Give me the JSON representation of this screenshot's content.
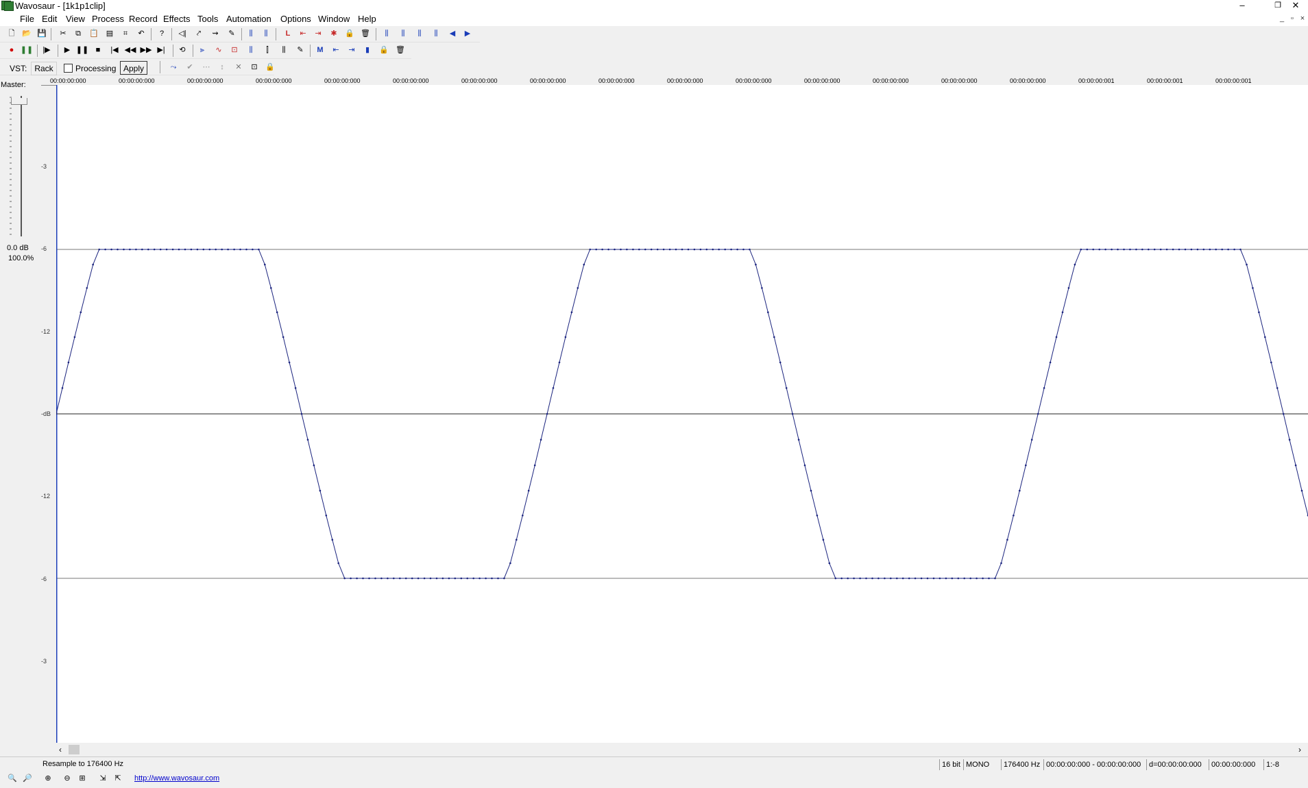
{
  "window": {
    "title": "Wavosaur - [1k1p1clip]",
    "controls": [
      "–",
      "❐",
      "✕"
    ],
    "mdi_controls": [
      "_",
      "▫",
      "×"
    ]
  },
  "menu": [
    "File",
    "Edit",
    "View",
    "Process",
    "Record",
    "Effects",
    "Tools",
    "Automation",
    "Options",
    "Window",
    "Help"
  ],
  "toolbar1": [
    "🗋",
    "📂",
    "💾",
    "✂",
    "⧉",
    "📋",
    "▤",
    "⌗",
    "↶",
    "?",
    "◁|",
    "⤤",
    "⇝",
    "✎",
    "⫼",
    "⫼",
    "L",
    "⇤",
    "⇥",
    "✱",
    "🔒",
    "🗑",
    "⫼",
    "⫼",
    "⫼",
    "⫼",
    "◀",
    "▶"
  ],
  "toolbar2": [
    "●",
    "❚❚",
    "|▶",
    "▶",
    "❚❚",
    "■",
    "|◀",
    "◀◀",
    "▶▶",
    "▶|",
    "⟲",
    "⫸",
    "∿",
    "⊡",
    "⫼",
    "⫿",
    "⫼",
    "✎",
    "M",
    "⇤",
    "⇥",
    "▮",
    "🔒",
    "🗑"
  ],
  "vst": {
    "label": "VST:",
    "rack": "Rack",
    "processing_label": "Processing",
    "apply": "Apply",
    "tools": [
      "⤳",
      "✔",
      "⋯",
      "↕",
      "✕",
      "⊡",
      "🔒"
    ]
  },
  "master": {
    "label": "Master:",
    "gain_db": "0.0 dB",
    "gain_pct": "100.0%",
    "slider_level": 1.0
  },
  "y_labels": [
    "-3",
    "-6",
    "-12",
    "-dB",
    "-12",
    "-6",
    "-3"
  ],
  "ruler_ticks": [
    "00:00:00:000",
    "00:00:00:000",
    "00:00:00:000",
    "00:00:00:000",
    "00:00:00:000",
    "00:00:00:000",
    "00:00:00:000",
    "00:00:00:000",
    "00:00:00:000",
    "00:00:00:000",
    "00:00:00:000",
    "00:00:00:000",
    "00:00:00:000",
    "00:00:00:000",
    "00:00:00:000",
    "00:00:00:001",
    "00:00:00:001",
    "00:00:00:001"
  ],
  "waveform": {
    "color": "#1a237e",
    "cycles_visible": 2.55,
    "clip_level": 0.5,
    "start_phase": 0
  },
  "status": {
    "message": "Resample to 176400 Hz",
    "bits": "16 bit",
    "channels": "MONO",
    "rate": "176400 Hz",
    "selection": "00:00:00:000 - 00:00:00:000",
    "duration": "d=00:00:00:000",
    "cursor": "00:00:00:000",
    "zoom": "1:-8"
  },
  "bottom": {
    "zoom_tools": [
      "🔍",
      "🔎",
      "⊕",
      "⊖",
      "⊞",
      "⇲",
      "⇱"
    ],
    "link": "http://www.wavosaur.com"
  }
}
